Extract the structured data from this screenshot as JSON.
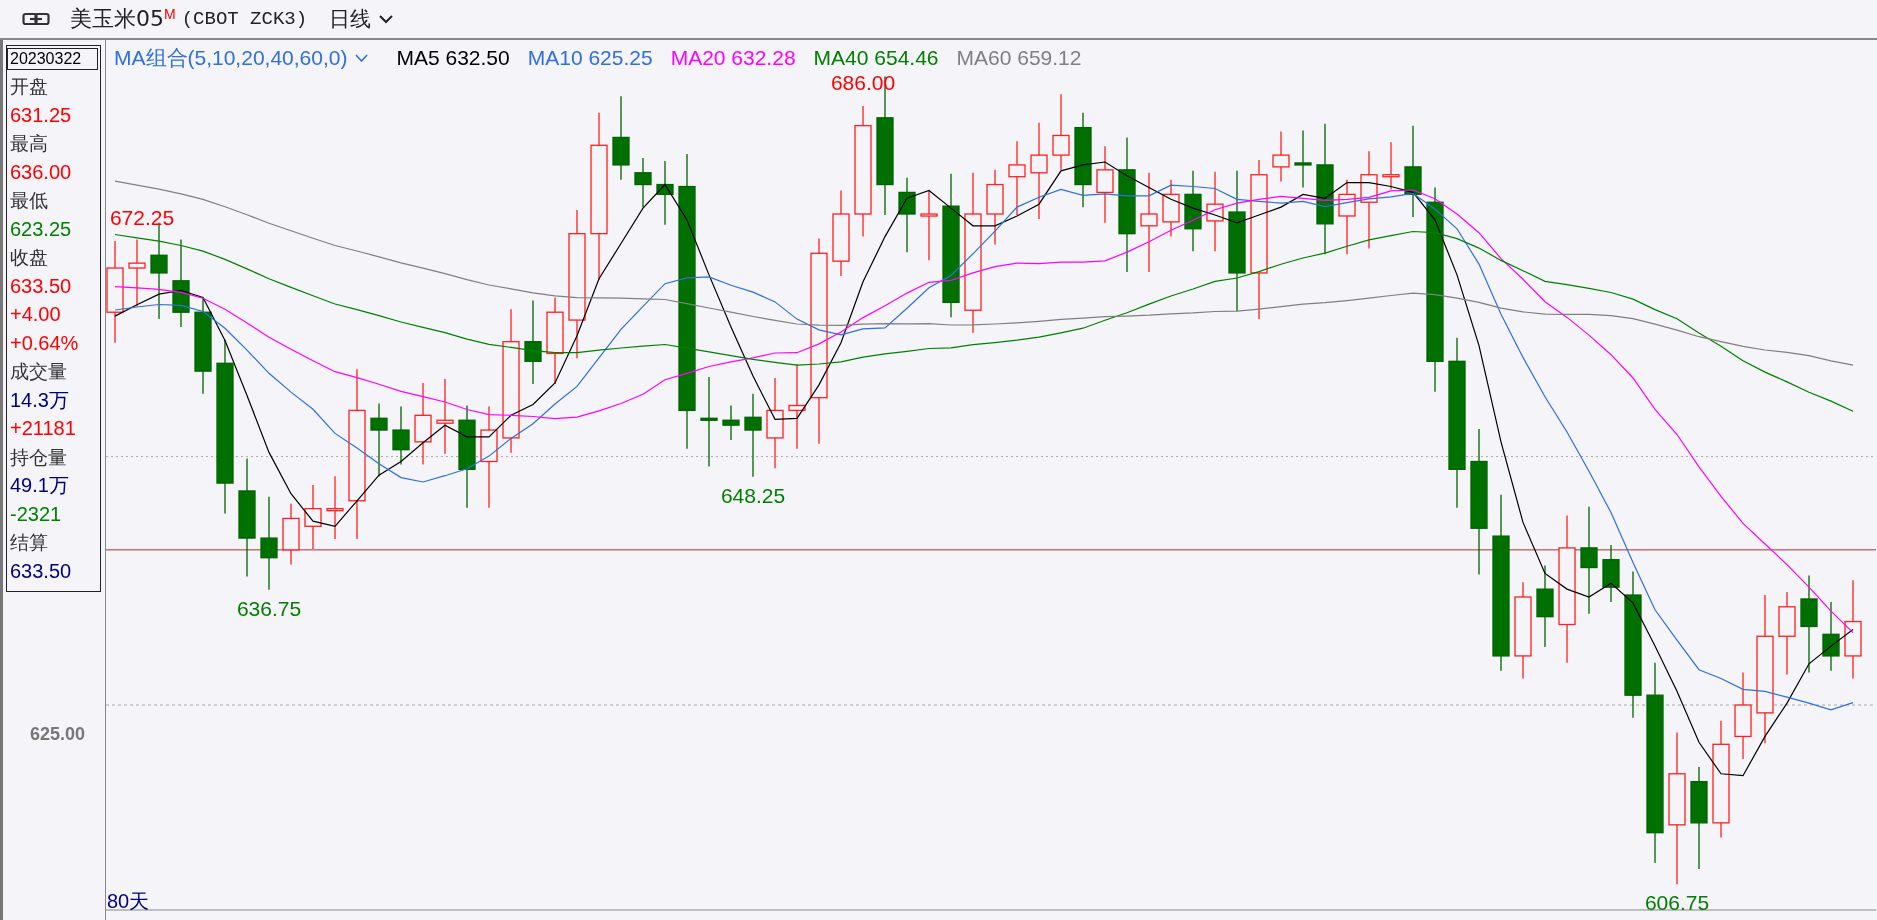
{
  "toolbar": {
    "instrument": "美玉米05",
    "badge": "M",
    "code": "(CBOT ZCK3)",
    "period": "日线"
  },
  "info_panel": {
    "date": "20230322",
    "lines": [
      {
        "text": "开盘",
        "kind": "label"
      },
      {
        "text": "631.25",
        "kind": "value",
        "color": "#ff0000"
      },
      {
        "text": "最高",
        "kind": "label"
      },
      {
        "text": "636.00",
        "kind": "value",
        "color": "#ff0000"
      },
      {
        "text": "最低",
        "kind": "label"
      },
      {
        "text": "623.25",
        "kind": "value",
        "color": "#008000"
      },
      {
        "text": "收盘",
        "kind": "label"
      },
      {
        "text": "633.50",
        "kind": "value",
        "color": "#ff0000"
      },
      {
        "text": "+4.00",
        "kind": "value",
        "color": "#ff0000"
      },
      {
        "text": "+0.64%",
        "kind": "value",
        "color": "#ff0000"
      },
      {
        "text": "成交量",
        "kind": "label"
      },
      {
        "text": "14.3万",
        "kind": "value",
        "color": "#000080"
      },
      {
        "text": "+21181",
        "kind": "value",
        "color": "#ff0000"
      },
      {
        "text": "持仓量",
        "kind": "label"
      },
      {
        "text": "49.1万",
        "kind": "value",
        "color": "#000080"
      },
      {
        "text": "-2321",
        "kind": "value",
        "color": "#008000"
      },
      {
        "text": "结算",
        "kind": "label"
      },
      {
        "text": "633.50",
        "kind": "value",
        "color": "#000080"
      }
    ]
  },
  "ma_legend": {
    "group": "MA组合(5,10,20,40,60,0)",
    "items": [
      {
        "label": "MA5 632.50",
        "color": "#000000"
      },
      {
        "label": "MA10 625.25",
        "color": "#2f6fde"
      },
      {
        "label": "MA20 632.28",
        "color": "#ff00ff"
      },
      {
        "label": "MA40 654.46",
        "color": "#008000"
      },
      {
        "label": "MA60 659.12",
        "color": "#808080"
      }
    ]
  },
  "chart": {
    "axis_label": "625.00",
    "period_label": "80天",
    "price_labels": [
      {
        "text": "672.25",
        "kind": "high"
      },
      {
        "text": "686.00",
        "kind": "high"
      },
      {
        "text": "636.75",
        "kind": "low"
      },
      {
        "text": "648.25",
        "kind": "low"
      },
      {
        "text": "606.75",
        "kind": "low"
      }
    ]
  }
}
